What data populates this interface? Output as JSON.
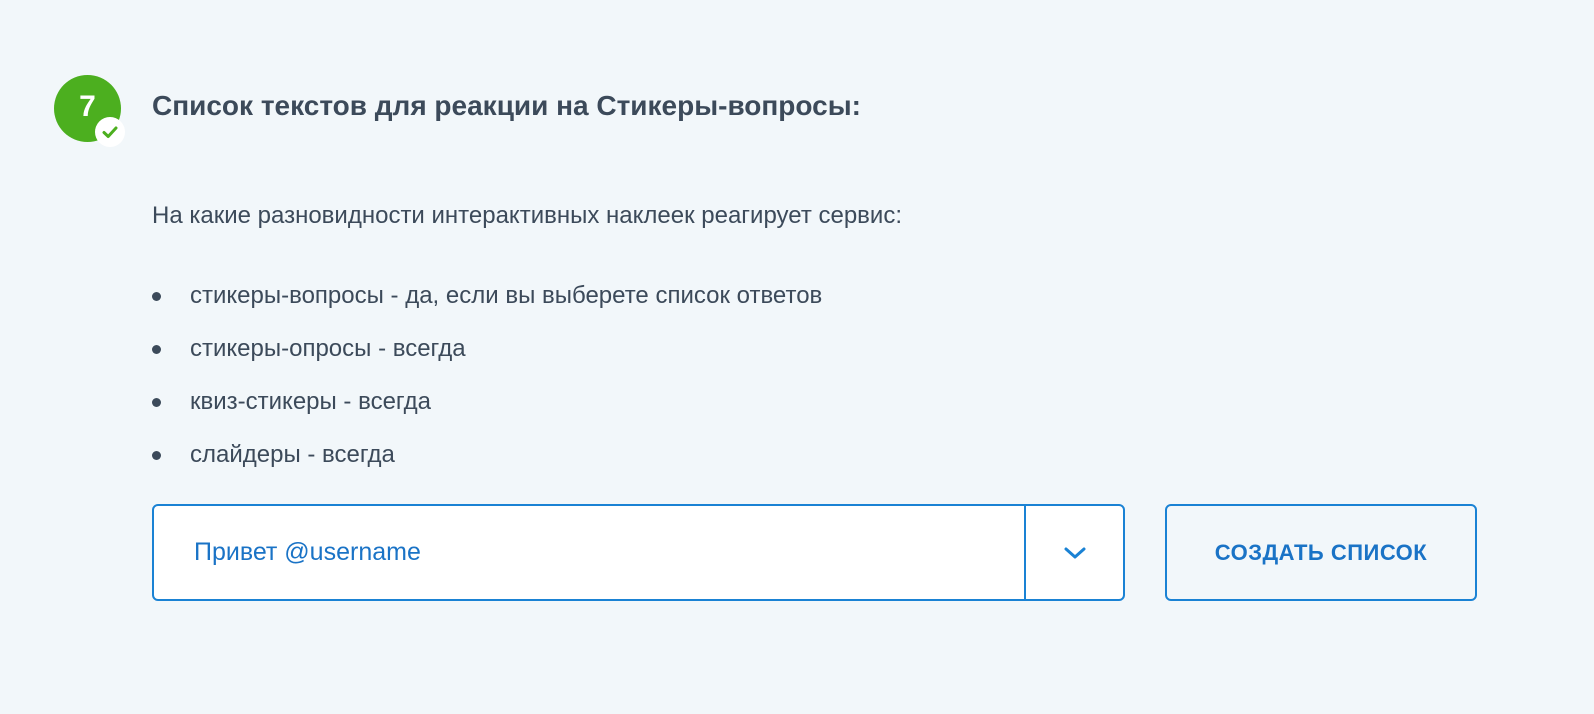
{
  "step": {
    "number": "7",
    "status_icon": "check-icon",
    "badge_color": "#4caf1f"
  },
  "section": {
    "title": "Список текстов для реакции на Стикеры-вопросы:",
    "intro": "На какие разновидности интерактивных наклеек реагирует сервис:",
    "items": [
      {
        "label": "стикеры-вопросы - да, если вы выберете список ответов"
      },
      {
        "label": "стикеры-опросы - всегда"
      },
      {
        "label": "квиз-стикеры - всегда"
      },
      {
        "label": "слайдеры - всегда"
      }
    ]
  },
  "controls": {
    "select": {
      "value": "Привет @username",
      "toggle_icon": "chevron-down-icon"
    },
    "create_button_label": "СОЗДАТЬ СПИСОК",
    "accent_color": "#1a82d4"
  }
}
